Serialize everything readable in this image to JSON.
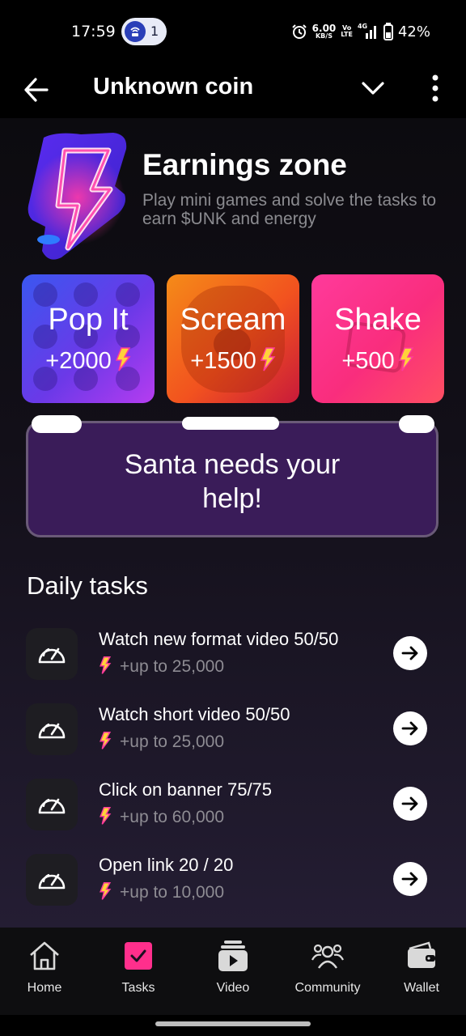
{
  "status_bar": {
    "time": "17:59",
    "notification_count": "1",
    "net_speed_value": "6.00",
    "net_speed_unit": "KB/S",
    "volte_top": "Vo",
    "volte_bottom": "LTE",
    "network_type": "4G",
    "battery": "42%"
  },
  "header": {
    "title": "Unknown coin",
    "back_icon": "arrow-left-icon",
    "chevron_icon": "chevron-down-icon",
    "more_icon": "more-vertical-icon"
  },
  "hero": {
    "title": "Earnings zone",
    "subtitle": "Play mini games and solve the tasks to earn $UNK and energy",
    "icon": "neon-lightning-icon"
  },
  "games": [
    {
      "title": "Pop It",
      "reward": "+2000"
    },
    {
      "title": "Scream",
      "reward": "+1500"
    },
    {
      "title": "Shake",
      "reward": "+500"
    }
  ],
  "santa": {
    "text": "Santa needs your help!"
  },
  "daily": {
    "heading": "Daily tasks",
    "tasks": [
      {
        "title": "Watch new format video 50/50",
        "reward": "+up to 25,000"
      },
      {
        "title": "Watch short video 50/50",
        "reward": "+up to 25,000"
      },
      {
        "title": "Click on banner 75/75",
        "reward": "+up to 60,000"
      },
      {
        "title": "Open link 20 / 20",
        "reward": "+up to 10,000"
      }
    ]
  },
  "nav": {
    "items": [
      {
        "label": "Home",
        "icon": "home-icon"
      },
      {
        "label": "Tasks",
        "icon": "tasks-icon"
      },
      {
        "label": "Video",
        "icon": "video-icon"
      },
      {
        "label": "Community",
        "icon": "community-icon"
      },
      {
        "label": "Wallet",
        "icon": "wallet-icon"
      }
    ],
    "active": "Tasks"
  },
  "colors": {
    "accent_pink": "#ff3a9b",
    "bolt_yellow": "#ffd23a",
    "santa_bg": "#3a1c59"
  }
}
